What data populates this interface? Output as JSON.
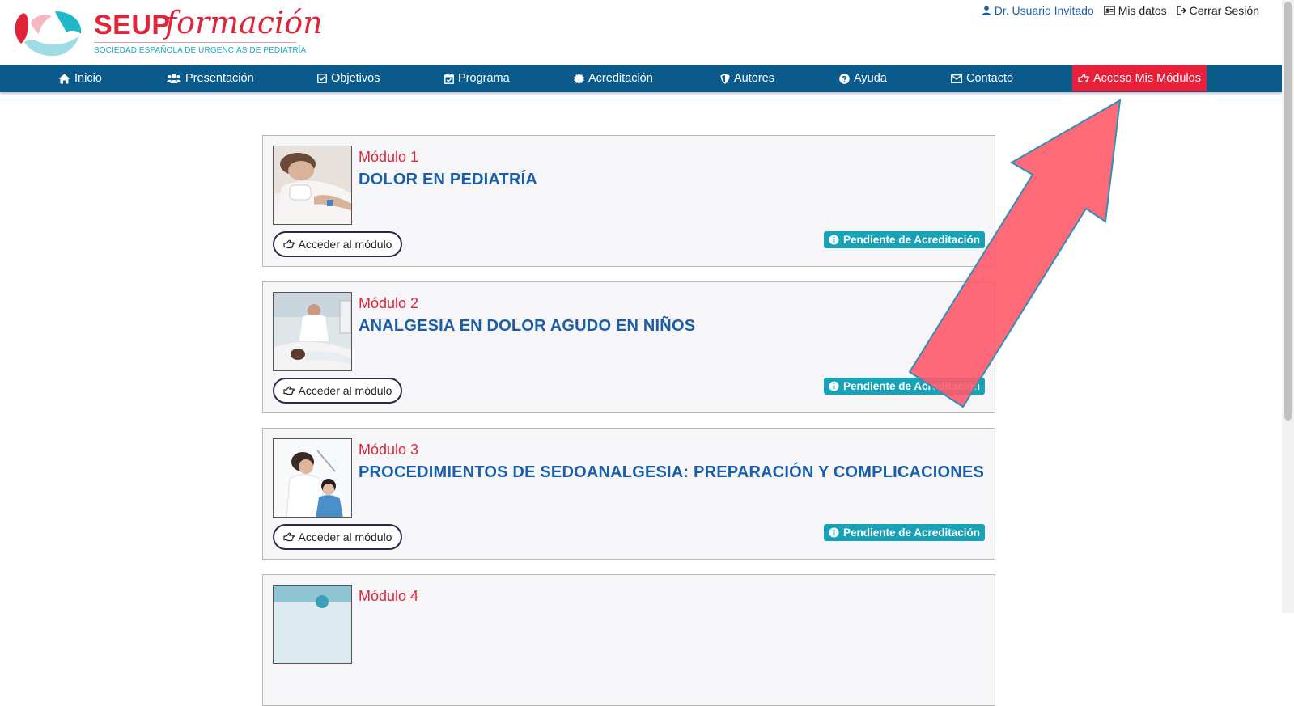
{
  "brand": {
    "name_primary": "SEUP",
    "name_secondary": "formación",
    "subtitle": "SOCIEDAD ESPAÑOLA DE URGENCIAS DE PEDIATRÍA"
  },
  "userbar": {
    "user": "Dr. Usuario Invitado",
    "my_data": "Mis datos",
    "logout": "Cerrar Sesión"
  },
  "nav": {
    "home": "Inicio",
    "presentation": "Presentación",
    "objectives": "Objetivos",
    "program": "Programa",
    "accreditation": "Acreditación",
    "authors": "Autores",
    "help": "Ayuda",
    "contact": "Contacto",
    "my_modules": "Acceso Mis Módulos"
  },
  "modules": [
    {
      "number": "Módulo 1",
      "title": "DOLOR EN PEDIATRÍA",
      "button": "Acceder al módulo",
      "status": "Pendiente de Acreditación"
    },
    {
      "number": "Módulo 2",
      "title": "ANALGESIA EN DOLOR AGUDO EN NIÑOS",
      "button": "Acceder al módulo",
      "status": "Pendiente de Acreditación"
    },
    {
      "number": "Módulo 3",
      "title": "PROCEDIMIENTOS DE SEDOANALGESIA: PREPARACIÓN Y COMPLICACIONES",
      "button": "Acceder al módulo",
      "status": "Pendiente de Acreditación"
    },
    {
      "number": "Módulo 4"
    }
  ],
  "colors": {
    "brand_red": "#e0243a",
    "nav_blue": "#0a5a8c",
    "title_blue": "#1a5ea8",
    "badge_teal": "#17a2b8",
    "cta_red": "#e8203a",
    "arrow_fill": "#ff5a6a"
  },
  "icons": {
    "home": "home-icon",
    "users": "users-icon",
    "check": "check-square-icon",
    "calendar": "calendar-check-icon",
    "cert": "certificate-icon",
    "shield": "shield-icon",
    "help": "question-circle-icon",
    "mail": "envelope-icon",
    "hand": "hand-point-right-icon",
    "info": "info-circle-icon",
    "user": "user-icon",
    "idcard": "id-card-icon",
    "logout": "sign-out-icon"
  }
}
